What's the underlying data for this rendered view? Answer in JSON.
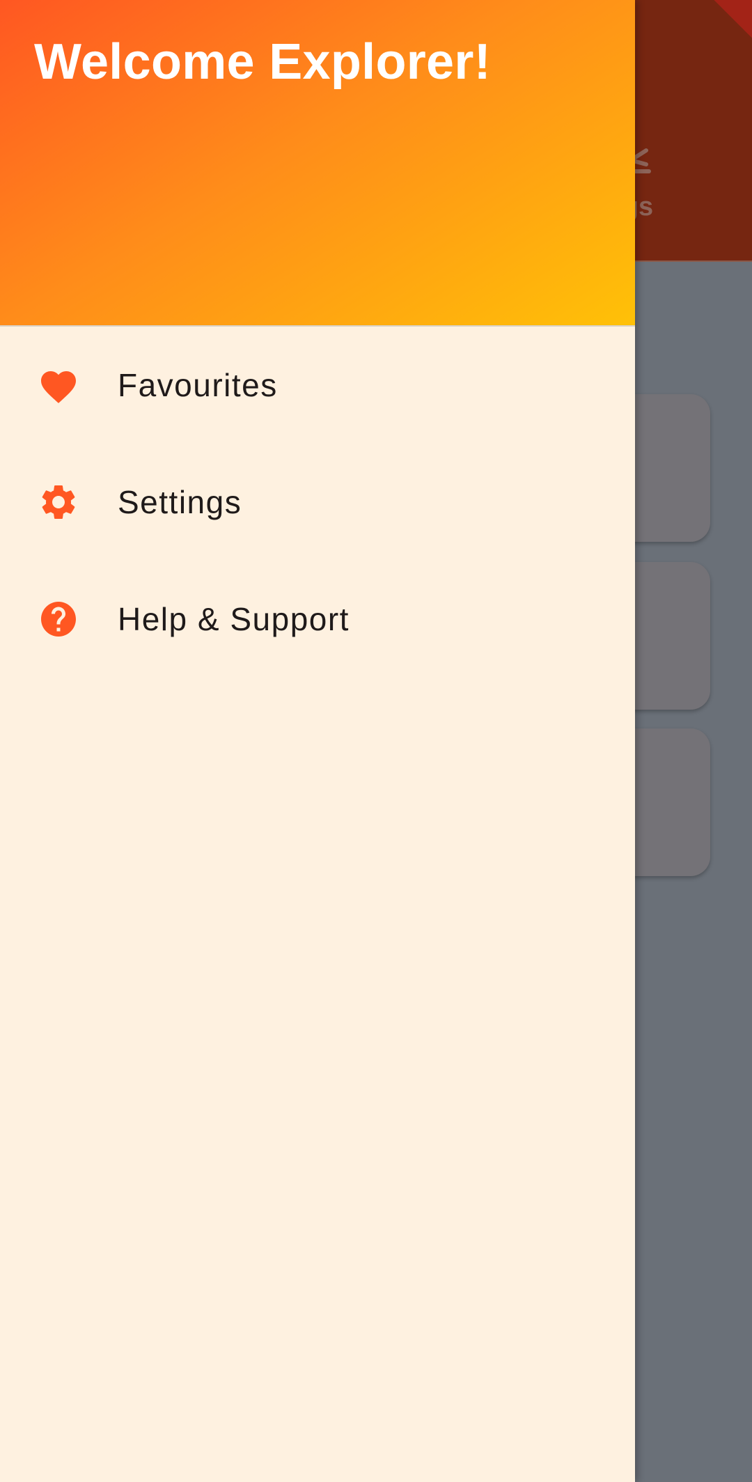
{
  "drawer": {
    "title": "Welcome Explorer!",
    "items": [
      {
        "label": "Favourites",
        "icon": "heart-icon"
      },
      {
        "label": "Settings",
        "icon": "gear-icon"
      },
      {
        "label": "Help & Support",
        "icon": "help-icon"
      }
    ]
  },
  "background_app": {
    "tab_label_partial": "ings"
  },
  "colors": {
    "accent": "#ff5722",
    "drawer_background": "#fef1e0",
    "header_gradient_start": "#ff5722",
    "header_gradient_end": "#ffc107"
  }
}
